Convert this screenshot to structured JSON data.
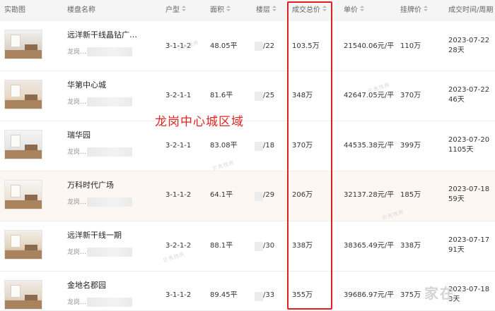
{
  "headers": {
    "photo": "实勘图",
    "name": "楼盘名称",
    "layout": "户型",
    "area": "面积",
    "floor": "楼层",
    "total": "成交总价",
    "unit": "单价",
    "listing": "挂牌价",
    "deal_time": "成交时间/周期"
  },
  "rows": [
    {
      "name": "远洋新干线晶钻广…",
      "district": "龙岗…",
      "layout": "3-1-1-2",
      "area": "48.05平",
      "floor": "/22",
      "total": "103.5万",
      "unit": "21540.06元/平",
      "listing": "110万",
      "date": "2023-07-22",
      "cycle": "28天"
    },
    {
      "name": "华第中心城",
      "district": "龙岗…",
      "layout": "3-2-1-1",
      "area": "81.6平",
      "floor": "/25",
      "total": "348万",
      "unit": "42647.05元/平",
      "listing": "370万",
      "date": "2023-07-22",
      "cycle": "46天"
    },
    {
      "name": "瑞华园",
      "district": "龙岗…",
      "layout": "3-2-1-1",
      "area": "83.08平",
      "floor": "/18",
      "total": "370万",
      "unit": "44535.38元/平",
      "listing": "399万",
      "date": "2023-07-20",
      "cycle": "1105天"
    },
    {
      "name": "万科时代广场",
      "district": "龙岗…",
      "layout": "3-1-1-2",
      "area": "64.1平",
      "floor": "/29",
      "total": "206万",
      "unit": "32137.28元/平",
      "listing": "185万",
      "date": "2023-07-18",
      "cycle": "59天"
    },
    {
      "name": "远洋新干线一期",
      "district": "龙岗…",
      "layout": "3-2-1-2",
      "area": "88.1平",
      "floor": "/30",
      "total": "338万",
      "unit": "38365.49元/平",
      "listing": "338万",
      "date": "2023-07-17",
      "cycle": "91天"
    },
    {
      "name": "金地名郡园",
      "district": "龙岗…",
      "layout": "3-1-1-2",
      "area": "89.45平",
      "floor": "/33",
      "total": "355万",
      "unit": "39686.97元/平",
      "listing": "375万",
      "date": "2023-07-18",
      "cycle": "3天"
    }
  ],
  "annotation": "龙岗中心城区域",
  "watermark": "贝壳找房",
  "logo": "家在",
  "colors": {
    "highlight": "#e02020",
    "header_bg": "#f5f5f5",
    "row_hover": "#fdf7f4"
  }
}
